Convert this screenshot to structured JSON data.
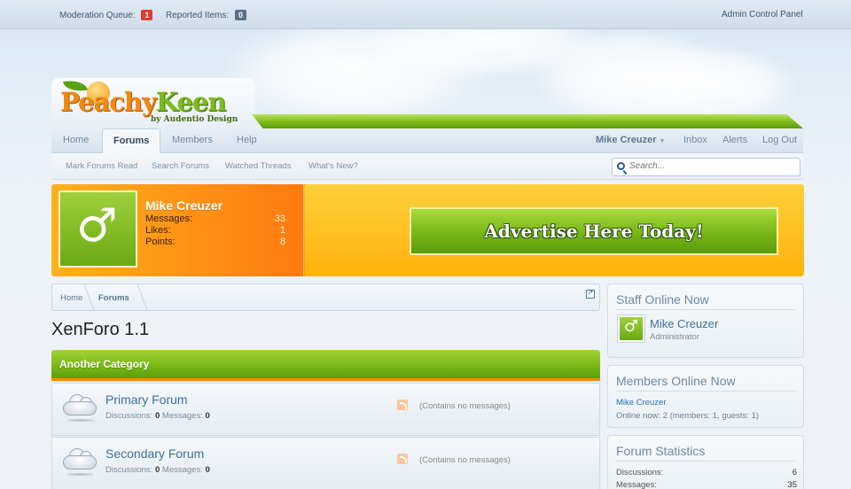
{
  "topbar": {
    "moderation_label": "Moderation Queue:",
    "moderation_count": "1",
    "reported_label": "Reported Items:",
    "reported_count": "0",
    "admin_link": "Admin Control Panel"
  },
  "logo": {
    "part1": "Peachy",
    "part2": "Keen",
    "tagline": "by Audentio Design"
  },
  "nav": {
    "tabs": [
      {
        "label": "Home"
      },
      {
        "label": "Forums",
        "active": true
      },
      {
        "label": "Members"
      },
      {
        "label": "Help"
      }
    ],
    "user": "Mike Creuzer",
    "inbox": "Inbox",
    "alerts": "Alerts",
    "logout": "Log Out"
  },
  "subnav": {
    "items": [
      "Mark Forums Read",
      "Search Forums",
      "Watched Threads",
      "What's New?"
    ],
    "search_placeholder": "Search..."
  },
  "visitor": {
    "name": "Mike Creuzer",
    "stats": [
      {
        "label": "Messages:",
        "value": "33"
      },
      {
        "label": "Likes:",
        "value": "1"
      },
      {
        "label": "Points:",
        "value": "8"
      }
    ]
  },
  "ad": {
    "text": "Advertise Here Today!"
  },
  "breadcrumb": {
    "items": [
      "Home",
      "Forums"
    ]
  },
  "page_title": "XenForo 1.1",
  "category": {
    "title": "Another Category"
  },
  "forums": [
    {
      "title": "Primary Forum",
      "discussions_label": "Discussions:",
      "discussions": "0",
      "messages_label": "Messages:",
      "messages": "0",
      "last": "(Contains no messages)"
    },
    {
      "title": "Secondary Forum",
      "discussions_label": "Discussions:",
      "discussions": "0",
      "messages_label": "Messages:",
      "messages": "0",
      "last": "(Contains no messages)"
    }
  ],
  "sidebar": {
    "staff": {
      "title": "Staff Online Now",
      "name": "Mike Creuzer",
      "role": "Administrator"
    },
    "members": {
      "title": "Members Online Now",
      "user": "Mike Creuzer",
      "count": "Online now: 2 (members: 1, guests: 1)"
    },
    "stats": {
      "title": "Forum Statistics",
      "rows": [
        {
          "label": "Discussions:",
          "value": "6"
        },
        {
          "label": "Messages:",
          "value": "35"
        }
      ]
    }
  },
  "colors": {
    "accent_green": "#77b617",
    "accent_orange": "#ff9a0d",
    "link_blue": "#3f6f9c"
  },
  "icons": [
    "search-icon",
    "male-avatar-icon",
    "cloud-forum-icon",
    "rss-icon",
    "jump-to-top-icon",
    "chevron-down-icon"
  ]
}
